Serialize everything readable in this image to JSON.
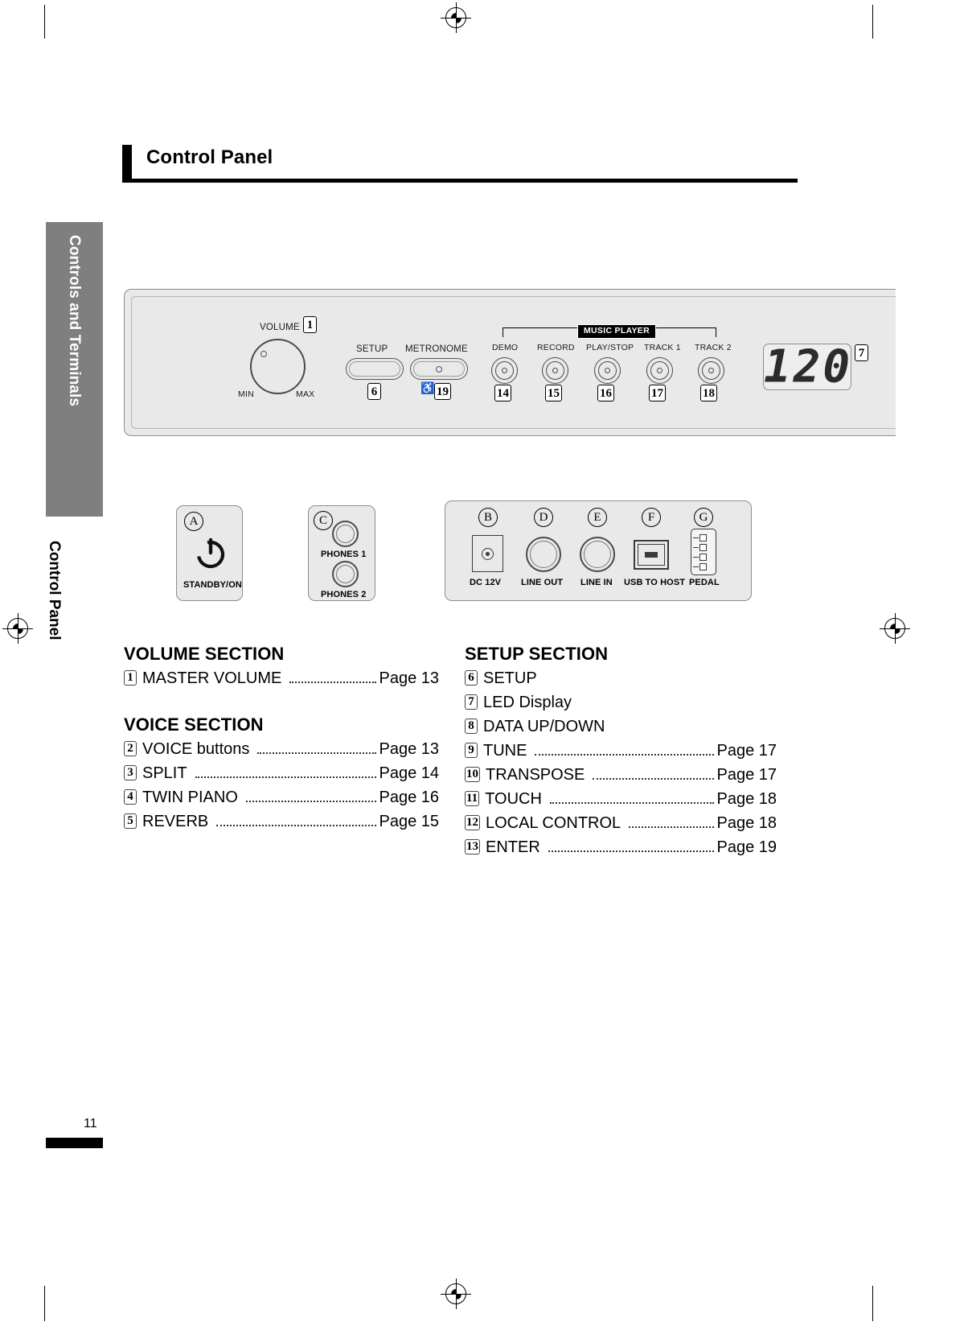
{
  "header": {
    "title": "Control Panel"
  },
  "side_tabs": {
    "upper": "Controls and Terminals",
    "lower": "Control Panel"
  },
  "panel": {
    "volume": {
      "title": "VOLUME",
      "min": "MIN",
      "max": "MAX",
      "callout": "1"
    },
    "buttons": [
      {
        "label": "SETUP",
        "callout": "6"
      },
      {
        "label": "METRONOME",
        "callout": "19"
      }
    ],
    "music_player": {
      "tag": "MUSIC PLAYER",
      "buttons": [
        {
          "label": "DEMO",
          "callout": "14"
        },
        {
          "label": "RECORD",
          "callout": "15"
        },
        {
          "label": "PLAY/STOP",
          "callout": "16"
        },
        {
          "label": "TRACK 1",
          "callout": "17"
        },
        {
          "label": "TRACK 2",
          "callout": "18"
        }
      ]
    },
    "led_display": {
      "value": "120",
      "callout": "7"
    }
  },
  "terminals": {
    "power": {
      "badge": "A",
      "label": "STANDBY/ON"
    },
    "phones": {
      "badge": "C",
      "jacks": [
        {
          "label": "PHONES 1"
        },
        {
          "label": "PHONES 2"
        }
      ]
    },
    "connectors": [
      {
        "badge": "B",
        "label": "DC 12V"
      },
      {
        "badge": "D",
        "label": "LINE OUT"
      },
      {
        "badge": "E",
        "label": "LINE IN"
      },
      {
        "badge": "F",
        "label": "USB TO HOST"
      },
      {
        "badge": "G",
        "label": "PEDAL"
      }
    ]
  },
  "legend": {
    "left": [
      {
        "heading": "VOLUME SECTION",
        "items": [
          {
            "num": "1",
            "label": "MASTER VOLUME",
            "page": "Page 13"
          }
        ]
      },
      {
        "heading": "VOICE SECTION",
        "items": [
          {
            "num": "2",
            "label": "VOICE buttons",
            "page": "Page 13"
          },
          {
            "num": "3",
            "label": "SPLIT",
            "page": "Page 14"
          },
          {
            "num": "4",
            "label": "TWIN PIANO",
            "page": "Page 16"
          },
          {
            "num": "5",
            "label": "REVERB",
            "page": "Page 15"
          }
        ]
      }
    ],
    "right": [
      {
        "heading": "SETUP SECTION",
        "items": [
          {
            "num": "6",
            "label": "SETUP",
            "page": ""
          },
          {
            "num": "7",
            "label": "LED Display",
            "page": ""
          },
          {
            "num": "8",
            "label": "DATA UP/DOWN",
            "page": ""
          },
          {
            "num": "9",
            "label": "TUNE",
            "page": "Page 17"
          },
          {
            "num": "10",
            "label": "TRANSPOSE",
            "page": "Page 17"
          },
          {
            "num": "11",
            "label": "TOUCH",
            "page": "Page 18"
          },
          {
            "num": "12",
            "label": "LOCAL CONTROL",
            "page": "Page 18"
          },
          {
            "num": "13",
            "label": "ENTER",
            "page": "Page 19"
          }
        ]
      }
    ]
  },
  "footer": {
    "page_number": "11"
  }
}
